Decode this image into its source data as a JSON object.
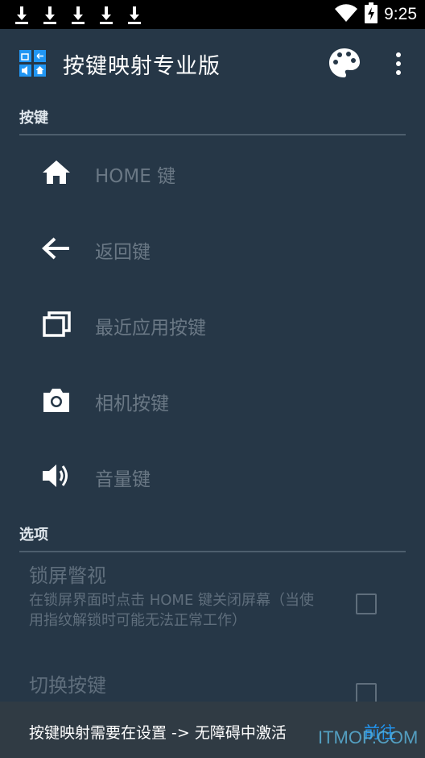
{
  "status_bar": {
    "time": "9:25",
    "icons": [
      "download-icon",
      "download-icon",
      "download-icon",
      "download-icon",
      "download-icon",
      "wifi-icon",
      "battery-charging-icon"
    ]
  },
  "app_bar": {
    "title": "按键映射专业版",
    "actions": [
      "palette-icon",
      "more-vert-icon"
    ]
  },
  "keys_section": {
    "header": "按键",
    "items": [
      {
        "label": "HOME 键",
        "icon": "home-icon"
      },
      {
        "label": "返回键",
        "icon": "back-arrow-icon"
      },
      {
        "label": "最近应用按键",
        "icon": "recent-apps-icon"
      },
      {
        "label": "相机按键",
        "icon": "camera-icon"
      },
      {
        "label": "音量键",
        "icon": "volume-icon"
      }
    ]
  },
  "options_section": {
    "header": "选项",
    "items": [
      {
        "title": "锁屏瞥视",
        "desc": "在锁屏界面时点击 HOME 键关闭屏幕（当使用指纹解锁时可能无法正常工作）",
        "checked": false
      },
      {
        "title": "切换按键",
        "desc": "",
        "checked": false
      }
    ]
  },
  "snackbar": {
    "message": "按键映射需要在设置 -> 无障碍中激活",
    "action": "前往"
  },
  "watermark": "ITMOP.COM",
  "colors": {
    "background": "#263747",
    "disabled_text": "#6a7885",
    "accent": "#2196f3"
  }
}
